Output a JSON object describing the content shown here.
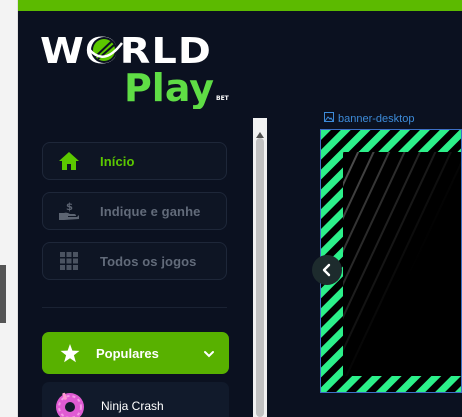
{
  "logo": {
    "word1": "WORLD",
    "word2": "Play",
    "suffix": "BET"
  },
  "menu": {
    "items": [
      {
        "label": "Início",
        "icon": "home-icon",
        "active": true
      },
      {
        "label": "Indique e ganhe",
        "icon": "hand-money-icon",
        "active": false
      },
      {
        "label": "Todos os jogos",
        "icon": "grid-icon",
        "active": false
      }
    ]
  },
  "categories": {
    "populares_label": "Populares",
    "icon": "star-icon",
    "expand_icon": "chevron-down-icon"
  },
  "games": [
    {
      "label": "Ninja Crash",
      "icon": "donut-icon"
    }
  ],
  "banner": {
    "label": "banner-desktop",
    "icon": "image-icon"
  },
  "colors": {
    "accent": "#5cba00",
    "background": "#0b1120",
    "stripe": "#2cf08a",
    "banner_outline": "#3d6fc4"
  }
}
